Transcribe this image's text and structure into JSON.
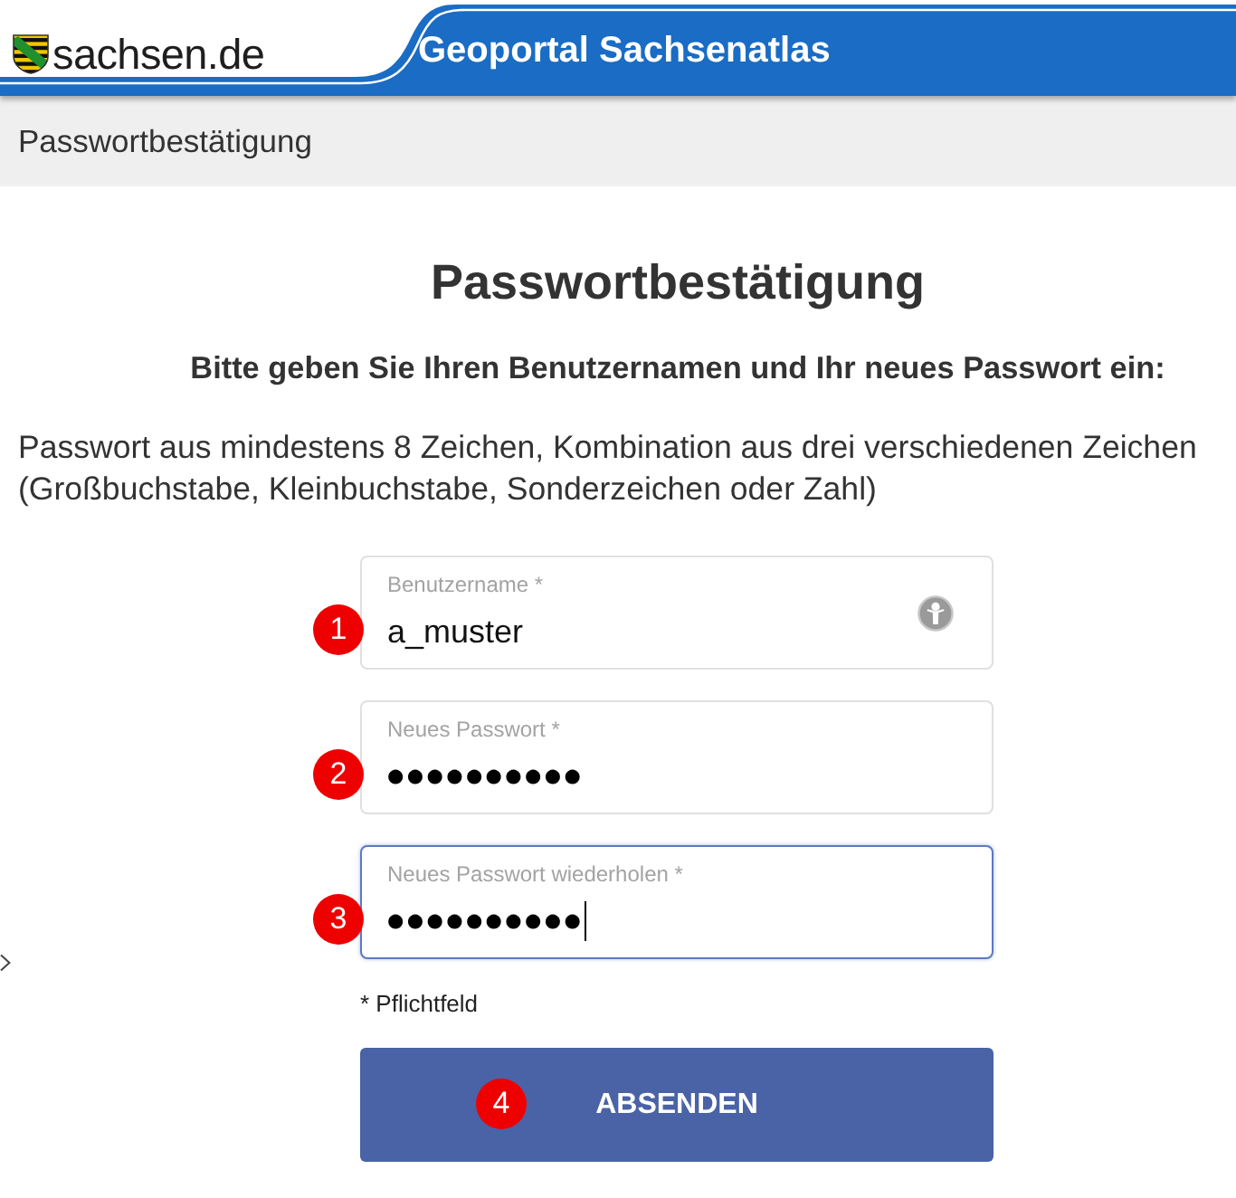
{
  "header": {
    "logo_text": "sachsen.de",
    "title": "Geoportal Sachsenatlas"
  },
  "breadcrumb": "Passwortbestätigung",
  "heading": "Passwortbestätigung",
  "instruction": "Bitte geben Sie Ihren Benutzernamen und Ihr neues Passwort ein:",
  "hint": "Passwort aus mindestens 8 Zeichen, Kombination aus drei verschiedenen Zeichen (Großbuchstabe, Kleinbuchstabe, Sonderzeichen oder Zahl)",
  "fields": [
    {
      "kind": "text",
      "label": "Benutzername *",
      "value": "a_muster",
      "focused": false,
      "autofill_icon": true,
      "marker": "1"
    },
    {
      "kind": "password",
      "label": "Neues Passwort *",
      "value": "●●●●●●●●●●",
      "focused": false,
      "autofill_icon": false,
      "marker": "2"
    },
    {
      "kind": "password",
      "label": "Neues Passwort wiederholen *",
      "value": "●●●●●●●●●●",
      "focused": true,
      "autofill_icon": false,
      "marker": "3"
    }
  ],
  "required_note": "* Pflichtfeld",
  "submit": {
    "label": "ABSENDEN",
    "marker": "4"
  }
}
